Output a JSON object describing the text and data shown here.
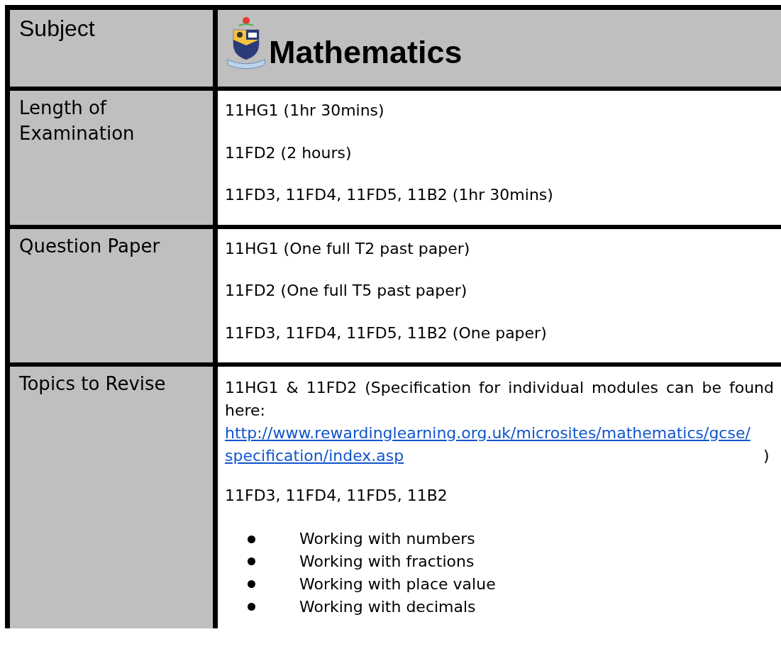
{
  "header": {
    "label": "Subject",
    "title": "Mathematics"
  },
  "rows": [
    {
      "label": "Length of Examination",
      "items": [
        {
          "kind": "text",
          "text": "11HG1 (1hr 30mins)"
        },
        {
          "kind": "text",
          "text": "11FD2 (2 hours)"
        },
        {
          "kind": "text",
          "text": "11FD3, 11FD4, 11FD5, 11B2 (1hr 30mins)"
        }
      ]
    },
    {
      "label": "Question Paper",
      "items": [
        {
          "kind": "text",
          "text": "11HG1 (One full T2 past paper)"
        },
        {
          "kind": "text",
          "text": "11FD2 (One full T5 past paper)"
        },
        {
          "kind": "text",
          "text": "11FD3, 11FD4, 11FD5, 11B2 (One paper)"
        }
      ]
    },
    {
      "label": "Topics to Revise",
      "items": [
        {
          "kind": "link_paragraph",
          "text": "11HG1 & 11FD2 (Specification for individual modules can be found here:",
          "link": "http://www.rewardinglearning.org.uk/microsites/mathematics/gcse/specification/index.asp",
          "after": ")"
        },
        {
          "kind": "text",
          "text": "11FD3, 11FD4, 11FD5, 11B2"
        },
        {
          "kind": "bullets",
          "list": [
            "Working with numbers",
            "Working with fractions",
            "Working with place value",
            "Working with decimals"
          ]
        }
      ]
    }
  ]
}
